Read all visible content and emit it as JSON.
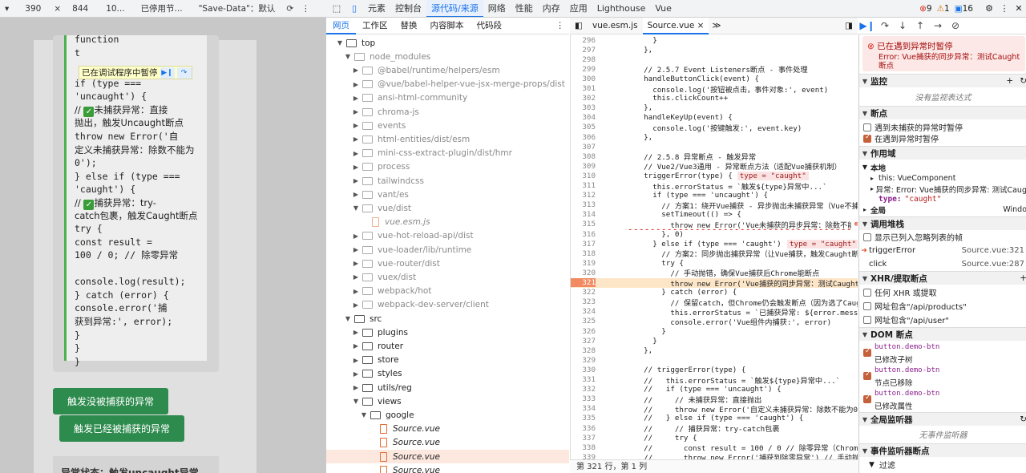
{
  "emulation": {
    "device_arrow": "▾",
    "width": "390",
    "times": "×",
    "height": "844",
    "zoom": "10...",
    "throttle": "已停用节...",
    "save_data": "\"Save-Data\"：默认"
  },
  "devtools_tabs": [
    "元素",
    "控制台",
    "源代码/来源",
    "网络",
    "性能",
    "内存",
    "应用",
    "Lighthouse",
    "Vue"
  ],
  "devtools_status": {
    "errors": "9",
    "warnings": "1",
    "issues": "16"
  },
  "page": {
    "code_lines": [
      "function",
      "t",
      "  if (type ===",
      "'uncaught') {",
      "    // ",
      "未捕获异常：直接",
      "抛出，触发Uncaught断点",
      "      throw new Error('自",
      "定义未捕获异常：除数不能为",
      "0');",
      "  } else if (type ===",
      "'caught') {",
      "    // ",
      "捕获异常：try-",
      "catch包裹，触发Caught断点",
      "      try {",
      "        const result =",
      "100 / 0; // 除零异常",
      "",
      "console.log(result);",
      "      } catch (error) {",
      "        console.error('捕",
      "获到异常:', error);",
      "      }",
      "    }",
      "  }"
    ],
    "paused_label": "已在调试程序中暂停",
    "btn_uncaught": "触发没被捕获的异常",
    "btn_caught": "触发已经被捕获的异常",
    "status_text": "异常状态：触发uncaught异常"
  },
  "sources_tabs": [
    "网页",
    "工作区",
    "替换",
    "内容脚本",
    "代码段"
  ],
  "tree": [
    {
      "label": "top",
      "indent": 0,
      "type": "folder",
      "open": true,
      "grey": false
    },
    {
      "label": "node_modules",
      "indent": 1,
      "type": "folder",
      "open": true,
      "grey": true
    },
    {
      "label": "@babel/runtime/helpers/esm",
      "indent": 2,
      "type": "folder",
      "open": false,
      "grey": true
    },
    {
      "label": "@vue/babel-helper-vue-jsx-merge-props/dist",
      "indent": 2,
      "type": "folder",
      "open": false,
      "grey": true
    },
    {
      "label": "ansi-html-community",
      "indent": 2,
      "type": "folder",
      "open": false,
      "grey": true
    },
    {
      "label": "chroma-js",
      "indent": 2,
      "type": "folder",
      "open": false,
      "grey": true
    },
    {
      "label": "events",
      "indent": 2,
      "type": "folder",
      "open": false,
      "grey": true
    },
    {
      "label": "html-entities/dist/esm",
      "indent": 2,
      "type": "folder",
      "open": false,
      "grey": true
    },
    {
      "label": "mini-css-extract-plugin/dist/hmr",
      "indent": 2,
      "type": "folder",
      "open": false,
      "grey": true
    },
    {
      "label": "process",
      "indent": 2,
      "type": "folder",
      "open": false,
      "grey": true
    },
    {
      "label": "tailwindcss",
      "indent": 2,
      "type": "folder",
      "open": false,
      "grey": true
    },
    {
      "label": "vant/es",
      "indent": 2,
      "type": "folder",
      "open": false,
      "grey": true
    },
    {
      "label": "vue/dist",
      "indent": 2,
      "type": "folder",
      "open": true,
      "grey": true
    },
    {
      "label": "vue.esm.js",
      "indent": 3,
      "type": "file",
      "open": false,
      "grey": true
    },
    {
      "label": "vue-hot-reload-api/dist",
      "indent": 2,
      "type": "folder",
      "open": false,
      "grey": true
    },
    {
      "label": "vue-loader/lib/runtime",
      "indent": 2,
      "type": "folder",
      "open": false,
      "grey": true
    },
    {
      "label": "vue-router/dist",
      "indent": 2,
      "type": "folder",
      "open": false,
      "grey": true
    },
    {
      "label": "vuex/dist",
      "indent": 2,
      "type": "folder",
      "open": false,
      "grey": true
    },
    {
      "label": "webpack/hot",
      "indent": 2,
      "type": "folder",
      "open": false,
      "grey": true
    },
    {
      "label": "webpack-dev-server/client",
      "indent": 2,
      "type": "folder",
      "open": false,
      "grey": true
    },
    {
      "label": "src",
      "indent": 1,
      "type": "folder",
      "open": true,
      "grey": false
    },
    {
      "label": "plugins",
      "indent": 2,
      "type": "folder",
      "open": false,
      "grey": false
    },
    {
      "label": "router",
      "indent": 2,
      "type": "folder",
      "open": false,
      "grey": false
    },
    {
      "label": "store",
      "indent": 2,
      "type": "folder",
      "open": false,
      "grey": false
    },
    {
      "label": "styles",
      "indent": 2,
      "type": "folder",
      "open": false,
      "grey": false
    },
    {
      "label": "utils/reg",
      "indent": 2,
      "type": "folder",
      "open": false,
      "grey": false
    },
    {
      "label": "views",
      "indent": 2,
      "type": "folder",
      "open": true,
      "grey": false
    },
    {
      "label": "google",
      "indent": 3,
      "type": "folder",
      "open": true,
      "grey": false
    },
    {
      "label": "Source.vue",
      "indent": 4,
      "type": "file",
      "open": false,
      "grey": false
    },
    {
      "label": "Source.vue",
      "indent": 4,
      "type": "file",
      "open": false,
      "grey": false
    },
    {
      "label": "Source.vue",
      "indent": 4,
      "type": "file",
      "open": false,
      "grey": false,
      "selected": true
    },
    {
      "label": "Source.vue",
      "indent": 4,
      "type": "file",
      "open": false,
      "grey": false
    }
  ],
  "editor_tabs": [
    "vue.esm.js",
    "Source.vue"
  ],
  "code": [
    {
      "n": "296",
      "t": "      }"
    },
    {
      "n": "297",
      "t": "    },"
    },
    {
      "n": "298",
      "t": ""
    },
    {
      "n": "299",
      "t": "    // 2.5.7 Event Listeners断点 - 事件处理",
      "c": "cm"
    },
    {
      "n": "300",
      "t": "    handleButtonClick(event) {"
    },
    {
      "n": "301",
      "t": "      console.log('按钮被点击，事件对象:', event)"
    },
    {
      "n": "302",
      "t": "      this.clickCount++"
    },
    {
      "n": "303",
      "t": "    },"
    },
    {
      "n": "304",
      "t": "    handleKeyUp(event) {"
    },
    {
      "n": "305",
      "t": "      console.log('按键触发:', event.key)"
    },
    {
      "n": "306",
      "t": "    },"
    },
    {
      "n": "307",
      "t": ""
    },
    {
      "n": "308",
      "t": "    // 2.5.8 异常断点 - 触发异常",
      "c": "cm"
    },
    {
      "n": "309",
      "t": "    // Vue2/Vue3通用 - 异常断点方法（适配Vue捕获机制）",
      "c": "cm"
    },
    {
      "n": "310",
      "t": "    triggerError(type) {",
      "inline": "type = \"caught\""
    },
    {
      "n": "311",
      "t": "      this.errorStatus = `触发${type}异常中...`"
    },
    {
      "n": "312",
      "t": "      if (type === 'uncaught') {"
    },
    {
      "n": "313",
      "t": "        // 方案1：绕开Vue捕获 - 异步抛出未捕获异常（Vue不捕获宏任务中",
      "c": "cm"
    },
    {
      "n": "314",
      "t": "        setTimeout(() => {"
    },
    {
      "n": "315",
      "t": "          throw new Error('Vue未捕获的异步异常：除数不能为0')",
      "c": "st",
      "err": true
    },
    {
      "n": "316",
      "t": "        }, 0)"
    },
    {
      "n": "317",
      "t": "      } else if (type === 'caught') {",
      "inline": "type = \"caught\""
    },
    {
      "n": "318",
      "t": "        // 方案2：同步抛出捕获异常（让Vue捕获，触发Caught断点）",
      "c": "cm"
    },
    {
      "n": "319",
      "t": "        try {"
    },
    {
      "n": "320",
      "t": "          // 手动抛错，确保Vue捕获后Chrome能断点",
      "c": "cm"
    },
    {
      "n": "321",
      "t": "          throw new Error('Vue捕获的同步异常：测试Caught断点')",
      "c": "st",
      "hl": true
    },
    {
      "n": "322",
      "t": "        } catch (error) {"
    },
    {
      "n": "323",
      "t": "          // 保留catch，但Chrome仍会触发断点（因为选了Caught）",
      "c": "cm"
    },
    {
      "n": "324",
      "t": "          this.errorStatus = `已捕获异常: ${error.message}`"
    },
    {
      "n": "325",
      "t": "          console.error('Vue组件内捕获:', error)"
    },
    {
      "n": "326",
      "t": "        }"
    },
    {
      "n": "327",
      "t": "      }"
    },
    {
      "n": "328",
      "t": "    },"
    },
    {
      "n": "329",
      "t": ""
    },
    {
      "n": "330",
      "t": "    // triggerError(type) {",
      "c": "cm"
    },
    {
      "n": "331",
      "t": "    //   this.errorStatus = `触发${type}异常中...`",
      "c": "cm"
    },
    {
      "n": "332",
      "t": "    //   if (type === 'uncaught') {",
      "c": "cm"
    },
    {
      "n": "333",
      "t": "    //     // 未捕获异常：直接抛出",
      "c": "cm"
    },
    {
      "n": "334",
      "t": "    //     throw new Error('自定义未捕获异常：除数不能为0')",
      "c": "cm"
    },
    {
      "n": "335",
      "t": "    //   } else if (type === 'caught') {",
      "c": "cm"
    },
    {
      "n": "336",
      "t": "    //     // 捕获异常：try-catch包裹",
      "c": "cm"
    },
    {
      "n": "337",
      "t": "    //     try {",
      "c": "cm"
    },
    {
      "n": "338",
      "t": "    //       const result = 100 / 0 // 除零异常（Chrome中返回In",
      "c": "cm"
    },
    {
      "n": "339",
      "t": "    //       throw new Error('捕获到除零异常') // 手动抛错确保触发",
      "c": "cm"
    }
  ],
  "editor_status": "第 321 行，第 1 列",
  "right": {
    "paused_title": "已在遇到异常时暂停",
    "paused_msg": "Error: Vue捕获的同步异常：测试Caught断点",
    "watch": "监控",
    "watch_empty": "没有监视表达式",
    "breakpoints": "断点",
    "bp_uncaught": "遇到未捕获的异常时暂停",
    "bp_caught": "在遇到异常时暂停",
    "scope": "作用域",
    "scope_local": "本地",
    "scope_this": "this: VueComponent",
    "scope_exc": "异常: Error: Vue捕获的同步异常: 测试Caug",
    "scope_type_key": "type:",
    "scope_type_val": "\"caught\"",
    "scope_global": "全局",
    "scope_global_val": "Windo",
    "callstack": "调用堆栈",
    "cs_show": "显示已列入忽略列表的帧",
    "cs1_fn": "triggerError",
    "cs1_loc": "Source.vue:321",
    "cs2_fn": "click",
    "cs2_loc": "Source.vue:287",
    "xhr": "XHR/提取断点",
    "xhr1": "任何 XHR 或提取",
    "xhr2": "网址包含\"/api/products\"",
    "xhr3": "网址包含\"/api/user\"",
    "dom": "DOM 断点",
    "dom1_sel": "button.demo-btn",
    "dom1_lbl": "已修改子树",
    "dom2_sel": "button.demo-btn",
    "dom2_lbl": "节点已移除",
    "dom3_sel": "button.demo-btn",
    "dom3_lbl": "已修改属性",
    "global_listeners": "全局监听器",
    "no_listeners": "无事件监听器",
    "event_listeners": "事件监听器断点",
    "filter": "过滤"
  },
  "colors": {
    "accent": "#1a73e8",
    "error": "#d93025",
    "green_button": "#2e8b4e",
    "highlight": "#fde6c8"
  }
}
